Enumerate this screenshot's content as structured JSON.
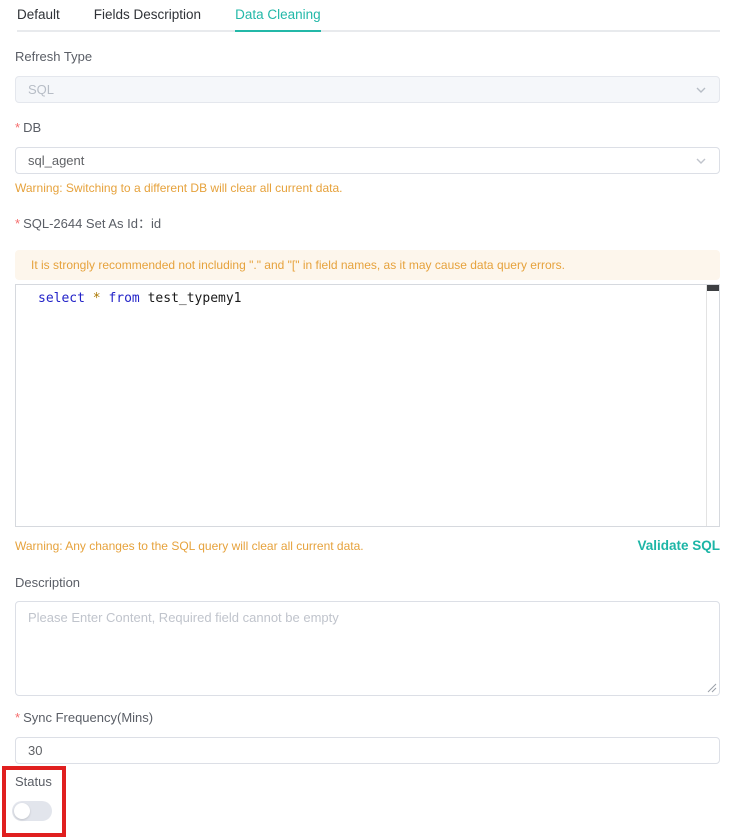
{
  "colors": {
    "accent_teal": "#23b8a8",
    "warning_orange": "#e6a23c",
    "alert_background": "#fdf6ec",
    "required_red": "#f56c6c",
    "annotation_red": "#e01f1f",
    "code_keyword_blue": "#2323c8"
  },
  "icons": {
    "select_chevron": "chevron-down-icon",
    "textarea_resize": "resize-grip-icon"
  },
  "required_marker": "*",
  "tabs": [
    {
      "label": "Default",
      "active": false
    },
    {
      "label": "Fields Description",
      "active": false
    },
    {
      "label": "Data Cleaning",
      "active": true
    }
  ],
  "form": {
    "refresh_type": {
      "label": "Refresh Type",
      "value": "SQL",
      "disabled": true
    },
    "db": {
      "label": "DB",
      "required": true,
      "value": "sql_agent",
      "warning": "Warning: Switching to a different DB will clear all current data."
    },
    "sql": {
      "label": "SQL-2644 Set As Id：id",
      "required": true,
      "alert": "It is strongly recommended not including \".\" and \"[\" in field names, as it may cause data query errors.",
      "code_tokens": [
        {
          "text": "select ",
          "type": "keyword"
        },
        {
          "text": "* ",
          "type": "operator"
        },
        {
          "text": "from ",
          "type": "keyword"
        },
        {
          "text": "test_typemy1",
          "type": "identifier"
        }
      ],
      "warning": "Warning: Any changes to the SQL query will clear all current data.",
      "validate_label": "Validate SQL"
    },
    "description": {
      "label": "Description",
      "value": "",
      "placeholder": "Please Enter Content, Required field cannot be empty"
    },
    "sync_frequency": {
      "label": "Sync Frequency(Mins)",
      "required": true,
      "value": "30"
    },
    "status": {
      "label": "Status",
      "toggle_on": false
    }
  }
}
